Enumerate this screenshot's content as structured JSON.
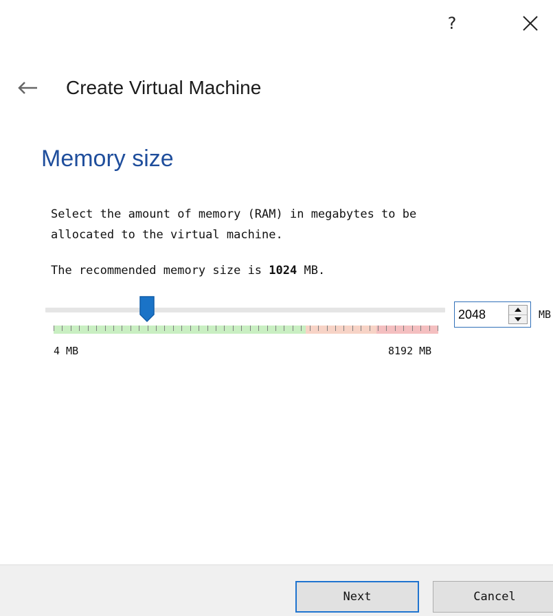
{
  "titlebar": {
    "help_label": "?",
    "close_icon": "close-icon"
  },
  "header": {
    "back_icon": "back-arrow-icon",
    "title": "Create Virtual Machine"
  },
  "page": {
    "heading": "Memory size",
    "description_line1": "Select the amount of memory (RAM) in megabytes to be",
    "description_line2": "allocated to the virtual machine.",
    "recommended_prefix": "The recommended memory size is ",
    "recommended_value": "1024",
    "recommended_suffix": " MB."
  },
  "memory": {
    "slider_min": 4,
    "slider_max": 8192,
    "slider_value": 2048,
    "min_label": "4 MB",
    "max_label": "8192 MB",
    "spin_value": "2048",
    "unit": "MB",
    "scale_colors": {
      "safe": "#c9efc2",
      "warning": "#f7d3c6",
      "danger": "#f4bfc0"
    }
  },
  "footer": {
    "next_label": "Next",
    "cancel_label": "Cancel"
  },
  "colors": {
    "accent": "#1e73cf",
    "heading": "#1f4e9c",
    "thumb": "#1a73c7"
  }
}
